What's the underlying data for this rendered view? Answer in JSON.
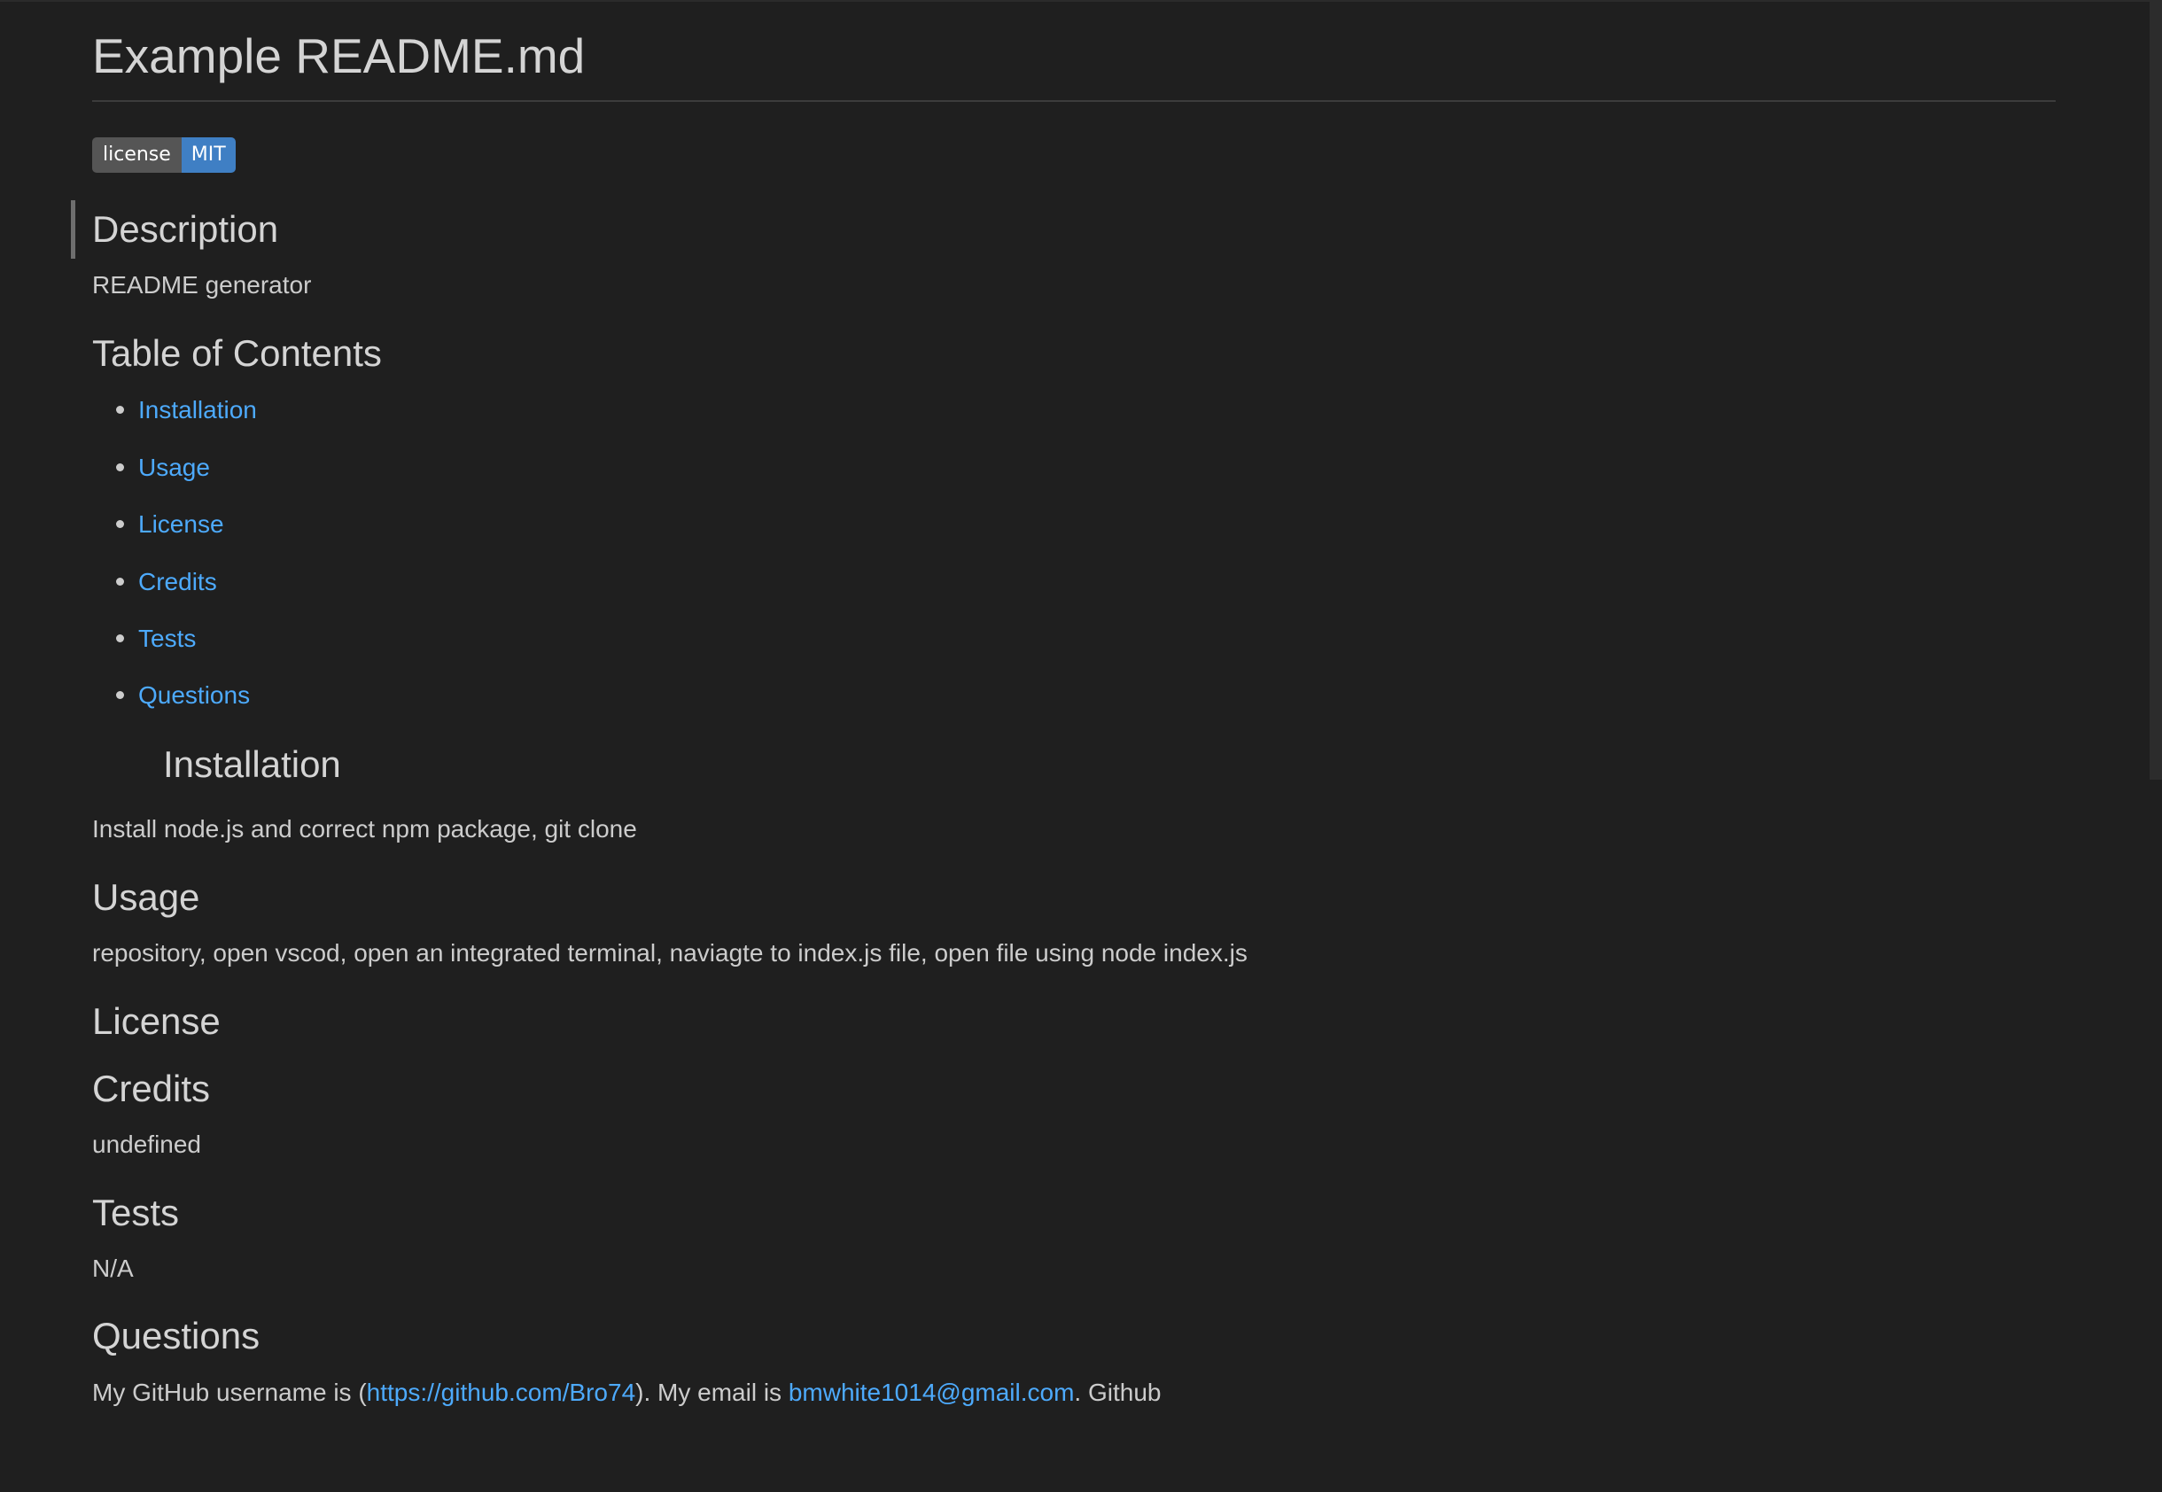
{
  "doc": {
    "title": "Example README.md",
    "badge": {
      "left": "license",
      "right": "MIT",
      "left_color": "#555555",
      "right_color": "#3f7fc4"
    },
    "description": {
      "heading": "Description",
      "text": "README generator"
    },
    "toc": {
      "heading": "Table of Contents",
      "items": [
        "Installation",
        "Usage",
        "License",
        "Credits",
        "Tests",
        "Questions"
      ]
    },
    "installation": {
      "heading": "Installation",
      "text": "Install node.js and correct npm package, git clone"
    },
    "usage": {
      "heading": "Usage",
      "text": "repository, open vscod, open an integrated terminal, naviagte to index.js file, open file using node index.js"
    },
    "license": {
      "heading": "License"
    },
    "credits": {
      "heading": "Credits",
      "text": "undefined"
    },
    "tests": {
      "heading": "Tests",
      "text": "N/A"
    },
    "questions": {
      "heading": "Questions",
      "prefix": "My GitHub username is (",
      "github_link": "https://github.com/Bro74",
      "middle": "). My email is ",
      "email_link": "bmwhite1014@gmail.com",
      "suffix": ". Github"
    }
  },
  "colors": {
    "background": "#1f1f1f",
    "link": "#4daafc",
    "text": "#cccccc"
  }
}
